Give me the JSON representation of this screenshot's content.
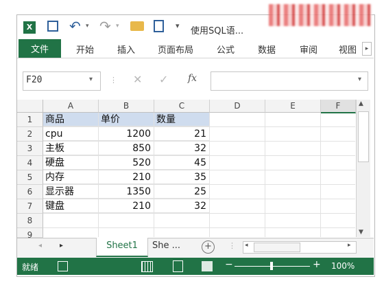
{
  "title_bar": {
    "title": "使用SQL语..."
  },
  "ribbon": {
    "tabs": [
      "文件",
      "开始",
      "插入",
      "页面布局",
      "公式",
      "数据",
      "审阅",
      "视图"
    ]
  },
  "formula_bar": {
    "name_box": "F20",
    "fx_label": "fx",
    "formula": ""
  },
  "grid": {
    "columns": [
      "A",
      "B",
      "C",
      "D",
      "E",
      "F"
    ],
    "row_numbers": [
      "1",
      "2",
      "3",
      "4",
      "5",
      "6",
      "7",
      "8",
      "9"
    ],
    "rows": [
      [
        "商品",
        "单价",
        "数量"
      ],
      [
        "cpu",
        "1200",
        "21"
      ],
      [
        "主板",
        "850",
        "32"
      ],
      [
        "硬盘",
        "520",
        "45"
      ],
      [
        "内存",
        "210",
        "35"
      ],
      [
        "显示器",
        "1350",
        "25"
      ],
      [
        "键盘",
        "210",
        "32"
      ]
    ]
  },
  "sheets": {
    "active": "Sheet1",
    "other": "She ..."
  },
  "status_bar": {
    "ready": "就绪",
    "zoom": "100%",
    "zoom_level": 1.0
  },
  "colors": {
    "excel_green": "#217346",
    "header_fill": "#cfdcee"
  }
}
